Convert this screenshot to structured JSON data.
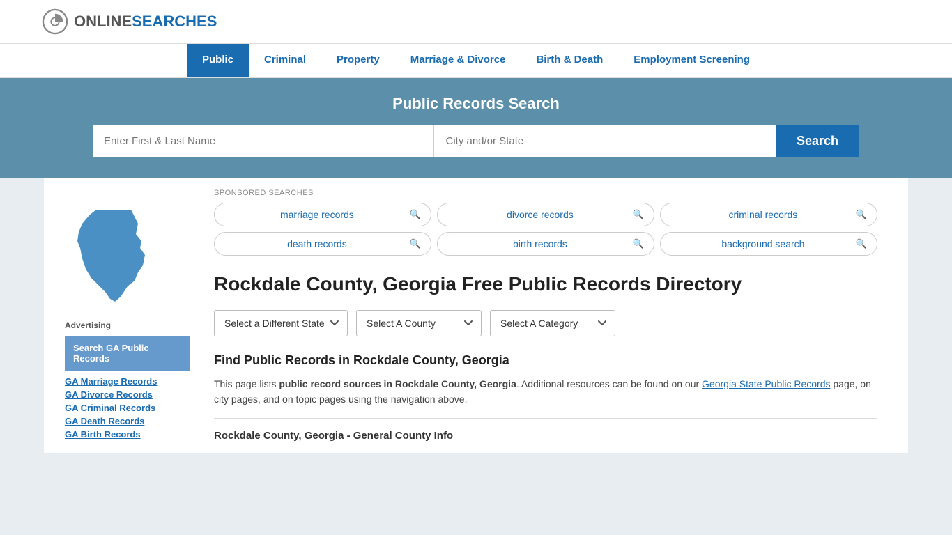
{
  "site": {
    "logo_online": "ONLINE",
    "logo_searches": "SEARCHES"
  },
  "nav": {
    "items": [
      {
        "label": "Public",
        "active": true
      },
      {
        "label": "Criminal",
        "active": false
      },
      {
        "label": "Property",
        "active": false
      },
      {
        "label": "Marriage & Divorce",
        "active": false
      },
      {
        "label": "Birth & Death",
        "active": false
      },
      {
        "label": "Employment Screening",
        "active": false
      }
    ]
  },
  "hero": {
    "title": "Public Records Search",
    "name_placeholder": "Enter First & Last Name",
    "location_placeholder": "City and/or State",
    "search_btn": "Search"
  },
  "sponsored": {
    "label": "SPONSORED SEARCHES",
    "pills": [
      {
        "text": "marriage records"
      },
      {
        "text": "divorce records"
      },
      {
        "text": "criminal records"
      },
      {
        "text": "death records"
      },
      {
        "text": "birth records"
      },
      {
        "text": "background search"
      }
    ]
  },
  "page": {
    "title": "Rockdale County, Georgia Free Public Records Directory",
    "dropdowns": {
      "state": "Select a Different State",
      "county": "Select A County",
      "category": "Select A Category"
    },
    "find_title": "Find Public Records in Rockdale County, Georgia",
    "find_text_prefix": "This page lists ",
    "find_text_bold": "public record sources in Rockdale County, Georgia",
    "find_text_suffix": ". Additional resources can be found on our ",
    "find_link": "Georgia State Public Records",
    "find_text_end": " page, on city pages, and on topic pages using the navigation above.",
    "county_info_title": "Rockdale County, Georgia - General County Info"
  },
  "sidebar": {
    "advertising_label": "Advertising",
    "ad_block_text": "Search GA Public Records",
    "links": [
      {
        "text": "GA Marriage Records"
      },
      {
        "text": "GA Divorce Records"
      },
      {
        "text": "GA Criminal Records"
      },
      {
        "text": "GA Death Records"
      },
      {
        "text": "GA Birth Records"
      }
    ]
  }
}
